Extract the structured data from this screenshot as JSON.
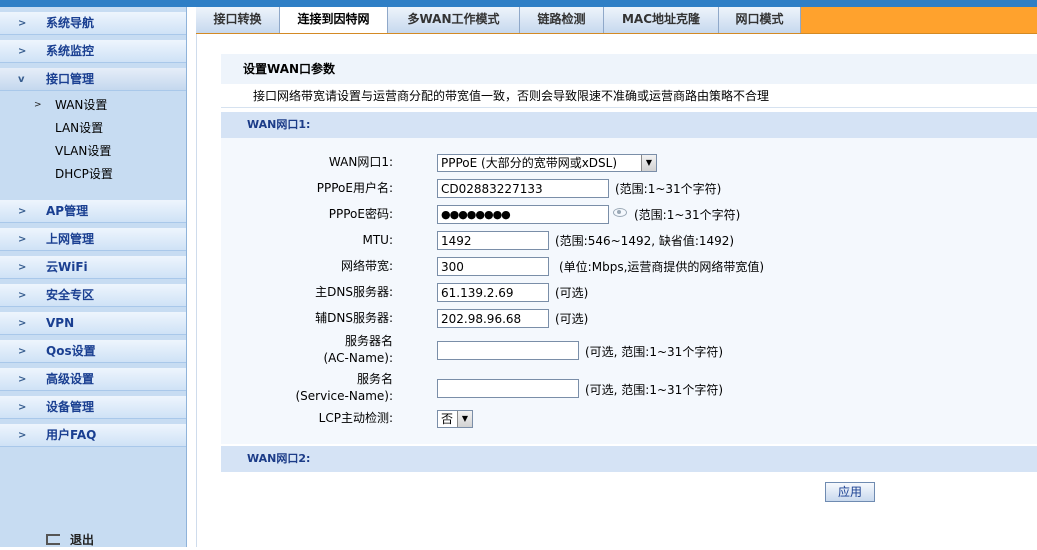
{
  "sidebar": {
    "items": [
      {
        "label": "系统导航"
      },
      {
        "label": "系统监控"
      },
      {
        "label": "接口管理"
      },
      {
        "label": "AP管理"
      },
      {
        "label": "上网管理"
      },
      {
        "label": "云WiFi"
      },
      {
        "label": "安全专区"
      },
      {
        "label": "VPN"
      },
      {
        "label": "Qos设置"
      },
      {
        "label": "高级设置"
      },
      {
        "label": "设备管理"
      },
      {
        "label": "用户FAQ"
      }
    ],
    "subitems": [
      {
        "label": "WAN设置"
      },
      {
        "label": "LAN设置"
      },
      {
        "label": "VLAN设置"
      },
      {
        "label": "DHCP设置"
      }
    ],
    "logout": "退出"
  },
  "tabs": [
    {
      "label": "接口转换"
    },
    {
      "label": "连接到因特网"
    },
    {
      "label": "多WAN工作模式"
    },
    {
      "label": "链路检测"
    },
    {
      "label": "MAC地址克隆"
    },
    {
      "label": "网口模式"
    }
  ],
  "panel": {
    "title": "设置WAN口参数",
    "notice": "接口网络带宽请设置与运营商分配的带宽值一致，否则会导致限速不准确或运营商路由策略不合理",
    "wan1_header": "WAN网口1:",
    "wan2_header": "WAN网口2:"
  },
  "form": {
    "wan_port_label": "WAN网口1:",
    "wan_port_value": "PPPoE (大部分的宽带网或xDSL)",
    "username_label": "PPPoE用户名:",
    "username_value": "CD02883227133",
    "username_hint": "(范围:1~31个字符)",
    "password_label": "PPPoE密码:",
    "password_value": "●●●●●●●●",
    "password_hint": "(范围:1~31个字符)",
    "mtu_label": "MTU:",
    "mtu_value": "1492",
    "mtu_hint": "(范围:546~1492, 缺省值:1492)",
    "bandwidth_label": "网络带宽:",
    "bandwidth_value": "300",
    "bandwidth_hint": "(单位:Mbps,运营商提供的网络带宽值)",
    "dns1_label": "主DNS服务器:",
    "dns1_value": "61.139.2.69",
    "dns1_hint": "(可选)",
    "dns2_label": "辅DNS服务器:",
    "dns2_value": "202.98.96.68",
    "dns2_hint": "(可选)",
    "acname_label_1": "服务器名",
    "acname_label_2": "(AC-Name):",
    "acname_value": "",
    "acname_hint": "(可选, 范围:1~31个字符)",
    "svcname_label_1": "服务名",
    "svcname_label_2": "(Service-Name):",
    "svcname_value": "",
    "svcname_hint": "(可选, 范围:1~31个字符)",
    "lcp_label": "LCP主动检测:",
    "lcp_value": "否"
  },
  "buttons": {
    "apply": "应用"
  }
}
